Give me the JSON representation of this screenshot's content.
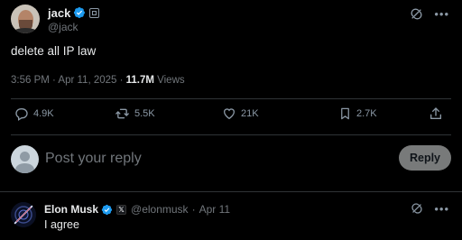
{
  "tweet": {
    "author_name": "jack",
    "author_handle": "@jack",
    "text": "delete all IP law",
    "timestamp": "3:56 PM · Apr 11, 2025 · ",
    "views_count": "11.7M",
    "views_label": " Views"
  },
  "actions": {
    "replies": "4.9K",
    "reposts": "5.5K",
    "likes": "21K",
    "bookmarks": "2.7K"
  },
  "composer": {
    "placeholder": "Post your reply",
    "reply_button": "Reply"
  },
  "reply": {
    "author_name": "Elon Musk",
    "affiliation_badge": "𝕏",
    "author_handle": "@elonmusk",
    "separator": "·",
    "date": "Apr 11",
    "text": "I agree"
  },
  "colors": {
    "background": "#000000",
    "text_primary": "#e7e9ea",
    "text_secondary": "#71767b",
    "verified_blue": "#1d9bf0",
    "divider": "#2f3336",
    "reply_button_bg": "#787a7a"
  },
  "icons": [
    "verified-badge-icon",
    "affiliate-badge-icon",
    "grok-icon",
    "more-icon",
    "reply-icon",
    "repost-icon",
    "like-icon",
    "bookmark-icon",
    "share-icon",
    "default-avatar-icon"
  ]
}
